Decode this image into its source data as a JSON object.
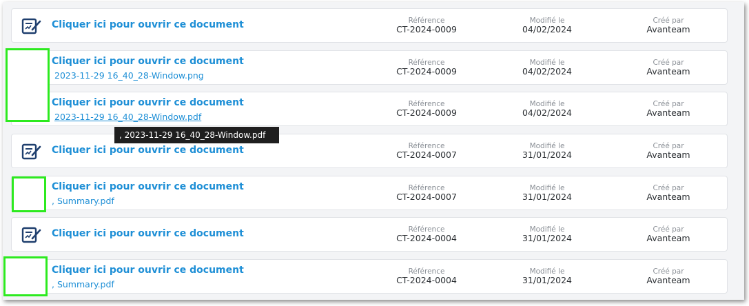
{
  "labels": {
    "reference": "Référence",
    "modified": "Modifié le",
    "created_by": "Créé par"
  },
  "rows": [
    {
      "title": "Cliquer ici pour ouvrir ce document",
      "reference": "CT-2024-0009",
      "modified": "04/02/2024",
      "created_by": "Avanteam"
    },
    {
      "title": "Cliquer ici pour ouvrir ce document",
      "subfile": "2023-11-29 16_40_28-Window.png",
      "reference": "CT-2024-0009",
      "modified": "04/02/2024",
      "created_by": "Avanteam"
    },
    {
      "title": "Cliquer ici pour ouvrir ce document",
      "subfile": "2023-11-29 16_40_28-Window.pdf",
      "reference": "CT-2024-0009",
      "modified": "04/02/2024",
      "created_by": "Avanteam"
    },
    {
      "title": "Cliquer ici pour ouvrir ce document",
      "reference": "CT-2024-0007",
      "modified": "31/01/2024",
      "created_by": "Avanteam"
    },
    {
      "title": "Cliquer ici pour ouvrir ce document",
      "subfile": ", Summary.pdf",
      "reference": "CT-2024-0007",
      "modified": "31/01/2024",
      "created_by": "Avanteam"
    },
    {
      "title": "Cliquer ici pour ouvrir ce document",
      "reference": "CT-2024-0004",
      "modified": "31/01/2024",
      "created_by": "Avanteam"
    },
    {
      "title": "Cliquer ici pour ouvrir ce document",
      "subfile": ", Summary.pdf",
      "reference": "CT-2024-0004",
      "modified": "31/01/2024",
      "created_by": "Avanteam"
    }
  ],
  "tooltip": ", 2023-11-29 16_40_28-Window.pdf",
  "colors": {
    "link": "#1e8fd6",
    "icon": "#1f3f6e",
    "highlight": "#2dea1f",
    "tooltip_bg": "#1f1f1f"
  },
  "icons": {
    "document": "document-edit-icon"
  }
}
